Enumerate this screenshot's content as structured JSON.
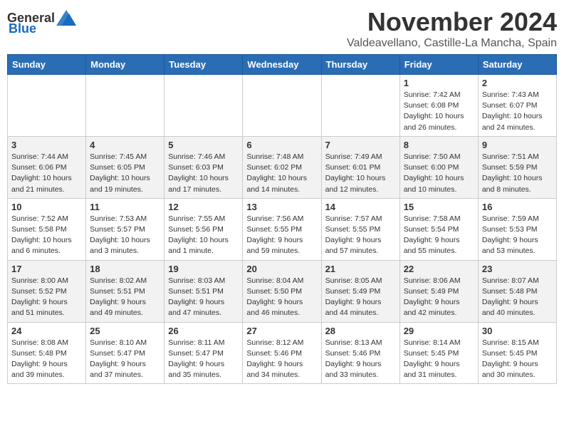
{
  "header": {
    "logo_general": "General",
    "logo_blue": "Blue",
    "month": "November 2024",
    "location": "Valdeavellano, Castille-La Mancha, Spain"
  },
  "days_of_week": [
    "Sunday",
    "Monday",
    "Tuesday",
    "Wednesday",
    "Thursday",
    "Friday",
    "Saturday"
  ],
  "weeks": [
    [
      {
        "day": "",
        "info": ""
      },
      {
        "day": "",
        "info": ""
      },
      {
        "day": "",
        "info": ""
      },
      {
        "day": "",
        "info": ""
      },
      {
        "day": "",
        "info": ""
      },
      {
        "day": "1",
        "info": "Sunrise: 7:42 AM\nSunset: 6:08 PM\nDaylight: 10 hours and 26 minutes."
      },
      {
        "day": "2",
        "info": "Sunrise: 7:43 AM\nSunset: 6:07 PM\nDaylight: 10 hours and 24 minutes."
      }
    ],
    [
      {
        "day": "3",
        "info": "Sunrise: 7:44 AM\nSunset: 6:06 PM\nDaylight: 10 hours and 21 minutes."
      },
      {
        "day": "4",
        "info": "Sunrise: 7:45 AM\nSunset: 6:05 PM\nDaylight: 10 hours and 19 minutes."
      },
      {
        "day": "5",
        "info": "Sunrise: 7:46 AM\nSunset: 6:03 PM\nDaylight: 10 hours and 17 minutes."
      },
      {
        "day": "6",
        "info": "Sunrise: 7:48 AM\nSunset: 6:02 PM\nDaylight: 10 hours and 14 minutes."
      },
      {
        "day": "7",
        "info": "Sunrise: 7:49 AM\nSunset: 6:01 PM\nDaylight: 10 hours and 12 minutes."
      },
      {
        "day": "8",
        "info": "Sunrise: 7:50 AM\nSunset: 6:00 PM\nDaylight: 10 hours and 10 minutes."
      },
      {
        "day": "9",
        "info": "Sunrise: 7:51 AM\nSunset: 5:59 PM\nDaylight: 10 hours and 8 minutes."
      }
    ],
    [
      {
        "day": "10",
        "info": "Sunrise: 7:52 AM\nSunset: 5:58 PM\nDaylight: 10 hours and 6 minutes."
      },
      {
        "day": "11",
        "info": "Sunrise: 7:53 AM\nSunset: 5:57 PM\nDaylight: 10 hours and 3 minutes."
      },
      {
        "day": "12",
        "info": "Sunrise: 7:55 AM\nSunset: 5:56 PM\nDaylight: 10 hours and 1 minute."
      },
      {
        "day": "13",
        "info": "Sunrise: 7:56 AM\nSunset: 5:55 PM\nDaylight: 9 hours and 59 minutes."
      },
      {
        "day": "14",
        "info": "Sunrise: 7:57 AM\nSunset: 5:55 PM\nDaylight: 9 hours and 57 minutes."
      },
      {
        "day": "15",
        "info": "Sunrise: 7:58 AM\nSunset: 5:54 PM\nDaylight: 9 hours and 55 minutes."
      },
      {
        "day": "16",
        "info": "Sunrise: 7:59 AM\nSunset: 5:53 PM\nDaylight: 9 hours and 53 minutes."
      }
    ],
    [
      {
        "day": "17",
        "info": "Sunrise: 8:00 AM\nSunset: 5:52 PM\nDaylight: 9 hours and 51 minutes."
      },
      {
        "day": "18",
        "info": "Sunrise: 8:02 AM\nSunset: 5:51 PM\nDaylight: 9 hours and 49 minutes."
      },
      {
        "day": "19",
        "info": "Sunrise: 8:03 AM\nSunset: 5:51 PM\nDaylight: 9 hours and 47 minutes."
      },
      {
        "day": "20",
        "info": "Sunrise: 8:04 AM\nSunset: 5:50 PM\nDaylight: 9 hours and 46 minutes."
      },
      {
        "day": "21",
        "info": "Sunrise: 8:05 AM\nSunset: 5:49 PM\nDaylight: 9 hours and 44 minutes."
      },
      {
        "day": "22",
        "info": "Sunrise: 8:06 AM\nSunset: 5:49 PM\nDaylight: 9 hours and 42 minutes."
      },
      {
        "day": "23",
        "info": "Sunrise: 8:07 AM\nSunset: 5:48 PM\nDaylight: 9 hours and 40 minutes."
      }
    ],
    [
      {
        "day": "24",
        "info": "Sunrise: 8:08 AM\nSunset: 5:48 PM\nDaylight: 9 hours and 39 minutes."
      },
      {
        "day": "25",
        "info": "Sunrise: 8:10 AM\nSunset: 5:47 PM\nDaylight: 9 hours and 37 minutes."
      },
      {
        "day": "26",
        "info": "Sunrise: 8:11 AM\nSunset: 5:47 PM\nDaylight: 9 hours and 35 minutes."
      },
      {
        "day": "27",
        "info": "Sunrise: 8:12 AM\nSunset: 5:46 PM\nDaylight: 9 hours and 34 minutes."
      },
      {
        "day": "28",
        "info": "Sunrise: 8:13 AM\nSunset: 5:46 PM\nDaylight: 9 hours and 33 minutes."
      },
      {
        "day": "29",
        "info": "Sunrise: 8:14 AM\nSunset: 5:45 PM\nDaylight: 9 hours and 31 minutes."
      },
      {
        "day": "30",
        "info": "Sunrise: 8:15 AM\nSunset: 5:45 PM\nDaylight: 9 hours and 30 minutes."
      }
    ]
  ]
}
